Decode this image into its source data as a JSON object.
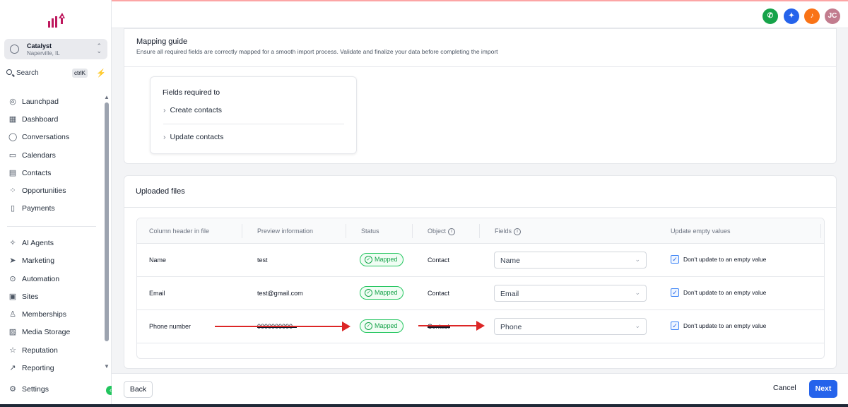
{
  "account": {
    "name": "Catalyst",
    "location": "Naperville, IL"
  },
  "search": {
    "label": "Search",
    "shortcut": "ctrlK"
  },
  "sidebar": {
    "items": [
      {
        "label": "Launchpad",
        "icon": "rocket-icon"
      },
      {
        "label": "Dashboard",
        "icon": "dashboard-icon"
      },
      {
        "label": "Conversations",
        "icon": "chat-icon"
      },
      {
        "label": "Calendars",
        "icon": "calendar-icon"
      },
      {
        "label": "Contacts",
        "icon": "contacts-icon"
      },
      {
        "label": "Opportunities",
        "icon": "opportunities-icon"
      },
      {
        "label": "Payments",
        "icon": "payments-icon"
      },
      {
        "label": "AI Agents",
        "icon": "sparkle-icon"
      },
      {
        "label": "Marketing",
        "icon": "send-icon"
      },
      {
        "label": "Automation",
        "icon": "automation-icon"
      },
      {
        "label": "Sites",
        "icon": "sites-icon"
      },
      {
        "label": "Memberships",
        "icon": "memberships-icon"
      },
      {
        "label": "Media Storage",
        "icon": "image-icon"
      },
      {
        "label": "Reputation",
        "icon": "star-icon"
      },
      {
        "label": "Reporting",
        "icon": "chart-icon"
      }
    ],
    "settings": "Settings"
  },
  "topbar": {
    "avatar_initials": "JC"
  },
  "mapping_guide": {
    "title": "Mapping guide",
    "subtitle": "Ensure all required fields are correctly mapped for a smooth import process. Validate and finalize your data before completing the import",
    "fields_title": "Fields required to",
    "items": [
      "Create contacts",
      "Update contacts"
    ]
  },
  "uploaded": {
    "title": "Uploaded files",
    "headers": [
      "Column header in file",
      "Preview information",
      "Status",
      "Object",
      "Fields",
      "Update empty values"
    ],
    "rows": [
      {
        "column": "Name",
        "preview": "test",
        "status": "Mapped",
        "object": "Contact",
        "field": "Name",
        "update": "Don't update to an empty value"
      },
      {
        "column": "Email",
        "preview": "test@gmail.com",
        "status": "Mapped",
        "object": "Contact",
        "field": "Email",
        "update": "Don't update to an empty value"
      },
      {
        "column": "Phone number",
        "preview": "0000000000",
        "status": "Mapped",
        "object": "Contact",
        "field": "Phone",
        "update": "Don't update to an empty value"
      }
    ]
  },
  "footer": {
    "back": "Back",
    "cancel": "Cancel",
    "next": "Next"
  },
  "colors": {
    "accent": "#2563eb",
    "mapped": "#16a34a",
    "annotation": "#dc2626"
  }
}
